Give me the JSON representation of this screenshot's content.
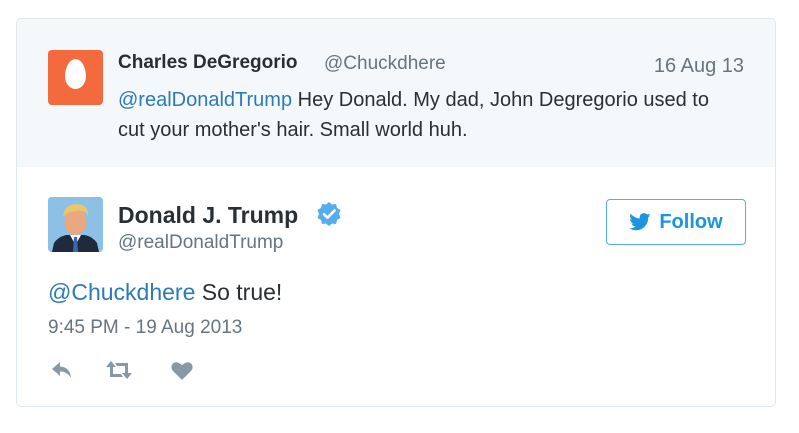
{
  "quoted_tweet": {
    "author_name": "Charles DeGregorio",
    "author_handle": "@Chuckdhere",
    "date": "16 Aug 13",
    "mention": "@realDonaldTrump",
    "text": " Hey Donald. My dad, John Degregorio used to cut your mother's hair. Small world huh."
  },
  "main_tweet": {
    "author_name": "Donald J. Trump",
    "author_handle": "@realDonaldTrump",
    "verified": true,
    "follow_label": "Follow",
    "mention": "@Chuckdhere",
    "text": " So true!",
    "timestamp": "9:45 PM - 19 Aug 2013"
  },
  "icons": {
    "verified": "verified-badge-icon",
    "follow": "twitter-bird-icon",
    "reply": "reply-icon",
    "retweet": "retweet-icon",
    "like": "heart-icon"
  },
  "colors": {
    "link": "#2b7bb9",
    "follow_accent": "#1b95e0",
    "egg_avatar": "#f26a3d",
    "quoted_bg": "#f5f8fa",
    "muted_text": "#66757f",
    "icon_gray": "#8899a6"
  }
}
